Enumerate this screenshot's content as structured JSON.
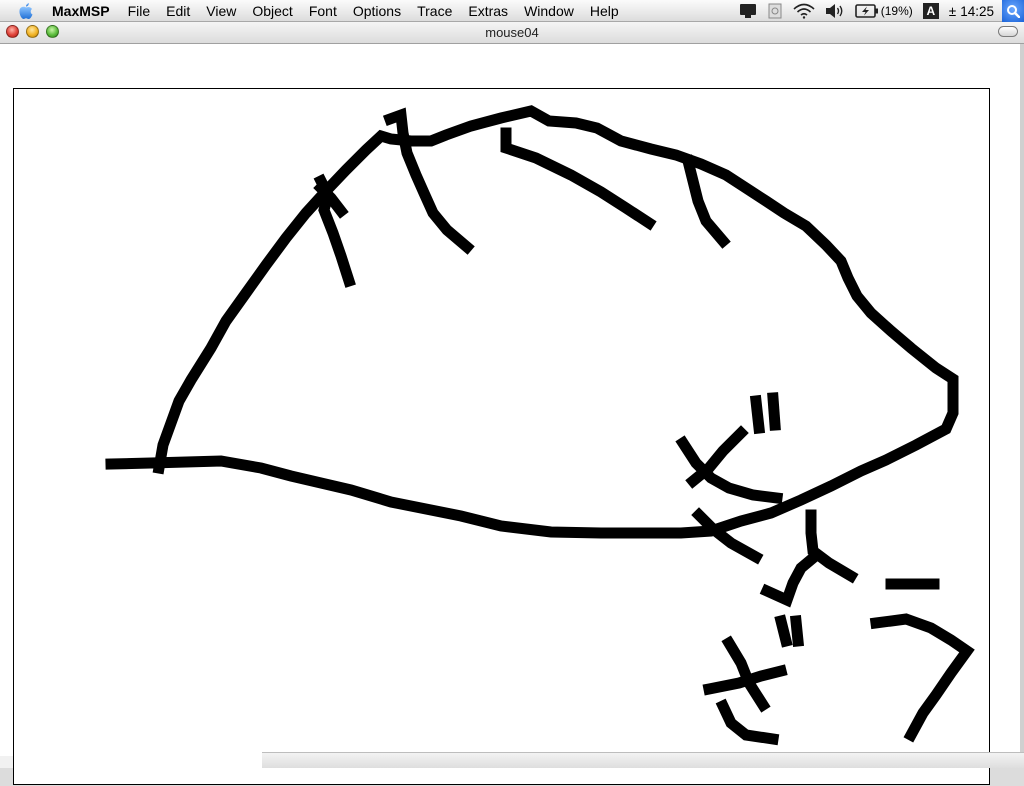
{
  "menubar": {
    "apple_icon": "apple-icon",
    "items": [
      {
        "label": "MaxMSP",
        "app": true
      },
      {
        "label": "File"
      },
      {
        "label": "Edit"
      },
      {
        "label": "View"
      },
      {
        "label": "Object"
      },
      {
        "label": "Font"
      },
      {
        "label": "Options"
      },
      {
        "label": "Trace"
      },
      {
        "label": "Extras"
      },
      {
        "label": "Window"
      },
      {
        "label": "Help"
      }
    ],
    "status": {
      "battery_percent": "(19%)",
      "input_menu_letter": "A",
      "clock_prefix": "±",
      "clock": "14:25"
    }
  },
  "window": {
    "title": "mouse04",
    "stroke_color": "#000000",
    "canvas_color": "#ffffff"
  }
}
